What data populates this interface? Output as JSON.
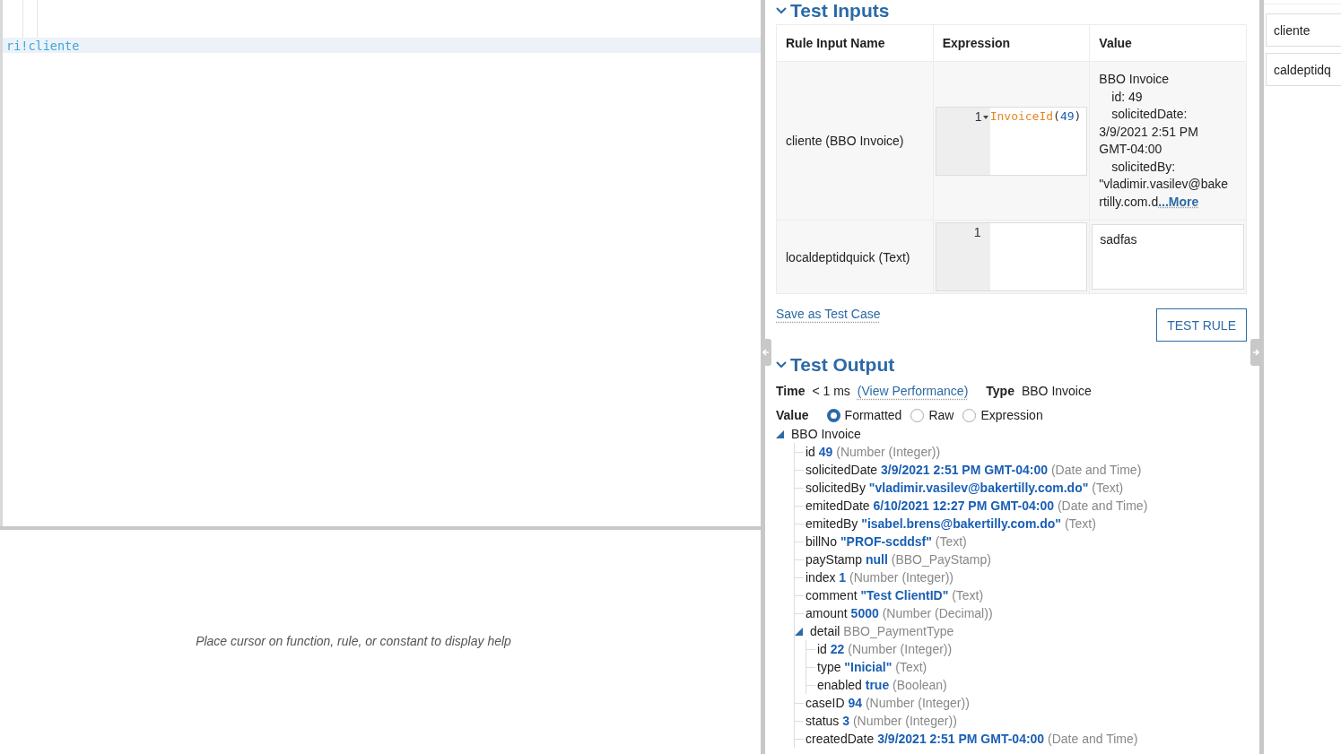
{
  "editor": {
    "current_line": "ri!cliente"
  },
  "help": {
    "text": "Place cursor on function, rule, or constant to display help"
  },
  "test_inputs": {
    "title": "Test Inputs",
    "expanded": true,
    "columns": [
      "Rule Input Name",
      "Expression",
      "Value"
    ],
    "rows": [
      {
        "name": "cliente (BBO Invoice)",
        "line_number": "1",
        "foldable": true,
        "tokens": [
          {
            "kind": "function",
            "text": "InvoiceId"
          },
          {
            "kind": "punct",
            "text": "("
          },
          {
            "kind": "number",
            "text": "49"
          },
          {
            "kind": "punct",
            "text": ")"
          }
        ],
        "value_lines": [
          {
            "text": "BBO Invoice",
            "indent": false
          },
          {
            "text": "id: 49",
            "indent": true
          },
          {
            "text": "solicitedDate:",
            "indent": true
          },
          {
            "text": "3/9/2021 2:51 PM",
            "indent": false
          },
          {
            "text": "GMT-04:00",
            "indent": false
          },
          {
            "text": "solicitedBy:",
            "indent": true
          },
          {
            "text": "\"vladimir.vasilev@bake",
            "indent": false
          },
          {
            "text": "rtilly.com.d",
            "indent": false
          }
        ],
        "more_link": "...More"
      },
      {
        "name": "localdeptidquick (Text)",
        "line_number": "1",
        "foldable": false,
        "tokens": [],
        "value": "sadfas"
      }
    ],
    "save_link": "Save as Test Case",
    "test_button": "TEST RULE"
  },
  "test_output": {
    "title": "Test Output",
    "expanded": true,
    "time_label": "Time",
    "time_value": "< 1 ms",
    "performance_link": "(View Performance)",
    "type_label": "Type",
    "type_value": "BBO Invoice",
    "value_label": "Value",
    "formats": [
      {
        "label": "Formatted",
        "selected": true
      },
      {
        "label": "Raw",
        "selected": false
      },
      {
        "label": "Expression",
        "selected": false
      }
    ],
    "tree": {
      "name": "BBO Invoice",
      "expanded": true,
      "children": [
        {
          "name": "id",
          "value": "49",
          "type": "(Number (Integer))"
        },
        {
          "name": "solicitedDate",
          "value": "3/9/2021 2:51 PM GMT-04:00",
          "type": "(Date and Time)"
        },
        {
          "name": "solicitedBy",
          "value": "\"vladimir.vasilev@bakertilly.com.do\"",
          "type": "(Text)"
        },
        {
          "name": "emitedDate",
          "value": "6/10/2021 12:27 PM GMT-04:00",
          "type": "(Date and Time)"
        },
        {
          "name": "emitedBy",
          "value": "\"isabel.brens@bakertilly.com.do\"",
          "type": "(Text)"
        },
        {
          "name": "billNo",
          "value": "\"PROF-scddsf\"",
          "type": "(Text)"
        },
        {
          "name": "payStamp",
          "value": "null",
          "type": "(BBO_PayStamp)"
        },
        {
          "name": "index",
          "value": "1",
          "type": "(Number (Integer))"
        },
        {
          "name": "comment",
          "value": "\"Test ClientID\"",
          "type": "(Text)"
        },
        {
          "name": "amount",
          "value": "5000",
          "type": "(Number (Decimal))"
        },
        {
          "name": "detail",
          "type": "BBO_PaymentType",
          "expanded": true,
          "children": [
            {
              "name": "id",
              "value": "22",
              "type": "(Number (Integer))"
            },
            {
              "name": "type",
              "value": "\"Inicial\"",
              "type": "(Text)"
            },
            {
              "name": "enabled",
              "value": "true",
              "type": "(Boolean)"
            }
          ]
        },
        {
          "name": "caseID",
          "value": "94",
          "type": "(Number (Integer))"
        },
        {
          "name": "status",
          "value": "3",
          "type": "(Number (Integer))"
        },
        {
          "name": "createdDate",
          "value": "3/9/2021 2:51 PM GMT-04:00",
          "type": "(Date and Time)"
        }
      ]
    }
  },
  "side_inputs": [
    "cliente",
    "caldeptidq"
  ]
}
